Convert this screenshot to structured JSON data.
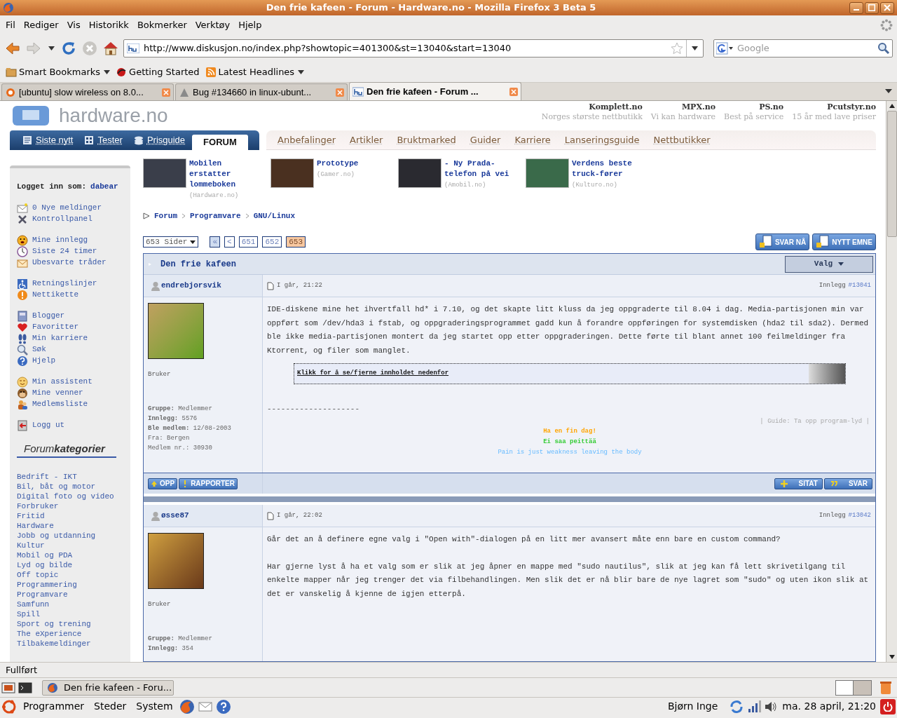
{
  "window": {
    "title": "Den frie kafeen - Forum - Hardware.no - Mozilla Firefox 3 Beta 5"
  },
  "menu": [
    "Fil",
    "Rediger",
    "Vis",
    "Historikk",
    "Bokmerker",
    "Verktøy",
    "Hjelp"
  ],
  "toolbar": {
    "url": "http://www.diskusjon.no/index.php?showtopic=401300&st=13040&start=13040",
    "search_placeholder": "Google"
  },
  "bookmarks": [
    {
      "label": "Smart Bookmarks",
      "menu": true
    },
    {
      "label": "Getting Started",
      "menu": false
    },
    {
      "label": "Latest Headlines",
      "menu": true
    }
  ],
  "tabs": [
    {
      "label": "[ubuntu] slow wireless on 8.0...",
      "selected": false
    },
    {
      "label": "Bug #134660 in linux-ubunt...",
      "selected": false
    },
    {
      "label": "Den frie kafeen - Forum ...",
      "selected": true
    }
  ],
  "page": {
    "logo": "hardware.no",
    "shops": [
      {
        "name": "Komplett.no",
        "tagline": "Norges største nettbutikk"
      },
      {
        "name": "MPX.no",
        "tagline": "Vi kan hardware"
      },
      {
        "name": "PS.no",
        "tagline": "Best på service"
      },
      {
        "name": "Pcutstyr.no",
        "tagline": "15 år med lave priser"
      }
    ],
    "nav_primary": [
      {
        "label": "Siste nytt",
        "selected": false
      },
      {
        "label": "Tester",
        "selected": false
      },
      {
        "label": "Prisguide",
        "selected": false
      },
      {
        "label": "FORUM",
        "selected": true
      }
    ],
    "nav_secondary": [
      "Anbefalinger",
      "Artikler",
      "Bruktmarked",
      "Guider",
      "Karriere",
      "Lanseringsguide",
      "Nettbutikker"
    ],
    "sidebar": {
      "logged_in_label": "Logget inn som:",
      "user": "dabear",
      "groups": [
        [
          "0 Nye meldinger",
          "Kontrollpanel"
        ],
        [
          "Mine innlegg",
          "Siste 24 timer",
          "Ubesvarte tråder"
        ],
        [
          "Retningslinjer",
          "Nettikette"
        ],
        [
          "Blogger",
          "Favoritter",
          "Min karriere",
          "Søk",
          "Hjelp"
        ],
        [
          "Min assistent",
          "Mine venner",
          "Medlemsliste"
        ],
        [
          "Logg ut"
        ]
      ],
      "categories_heading": "Forum**kategorier**",
      "categories": [
        "Bedrift - IKT",
        "Bil, båt og motor",
        "Digital foto og video",
        "Forbruker",
        "Fritid",
        "Hardware",
        "Jobb og utdanning",
        "Kultur",
        "Mobil og PDA",
        "Lyd og bilde",
        "Off topic",
        "Programmering",
        "Programvare",
        "Samfunn",
        "Spill",
        "Sport og trening",
        "The eXperience",
        "Tilbakemeldinger"
      ]
    },
    "news": [
      {
        "title": "Mobilen erstatter lommeboken",
        "source": "(Hardware.no)"
      },
      {
        "title": "Prototype",
        "source": "(Gamer.no)"
      },
      {
        "title": "- Ny Prada-telefon på vei",
        "source": "(Amobil.no)"
      },
      {
        "title": "Verdens beste truck-fører",
        "source": "(Kulturo.no)"
      }
    ],
    "breadcrumb": [
      "Forum",
      "Programvare",
      "GNU/Linux"
    ],
    "pager": {
      "pages_label": "653 Sider",
      "first": "«",
      "prev": "<",
      "pages": [
        {
          "label": "651",
          "selected": false
        },
        {
          "label": "652",
          "selected": false
        },
        {
          "label": "653",
          "selected": true
        }
      ]
    },
    "actions": [
      "SVAR NÅ",
      "NYTT EMNE"
    ],
    "topic": {
      "title": "Den frie kafeen",
      "options": "Valg"
    },
    "posts": [
      {
        "author": "endrebjorsvik",
        "time": "I går, 21:22",
        "post_label": "Innlegg",
        "post_number": "#13041",
        "rank": "Bruker",
        "info": [
          "**Gruppe:** Medlemmer",
          "**Innlegg:** 5576",
          "**Ble medlem:** 12/08-2003",
          "Fra: Bergen",
          "Medlem nr.: 30930"
        ],
        "paragraphs": [
          "IDE-diskene mine het ihvertfall hd* i 7.10, og det skapte litt kluss da jeg oppgraderte til 8.04 i dag. Media-partisjonen min var oppført som /dev/hda3 i fstab, og oppgraderingsprogrammet gadd kun å forandre oppføringen for systemdisken (hda2 til sda2). Dermed ble ikke media-partisjonen montert da jeg startet opp etter oppgraderingen. Dette førte til blant annet 100 feilmeldinger fra Ktorrent, og filer som manglet."
        ],
        "spoiler": "Klikk for å se/fjerne innholdet nedenfor",
        "signature": {
          "rule": "--------------------",
          "guide": "| Guide: Ta opp program-lyd |",
          "lines": [
            {
              "text": "Ha en fin dag!",
              "color": "#ffa500"
            },
            {
              "text": "Ei saa peittää",
              "color": "#33cc33"
            },
            {
              "text": "Pain is just weakness leaving the body",
              "color": "#66bbff"
            }
          ]
        },
        "footer_left": [
          "OPP",
          "RAPPORTER"
        ],
        "footer_right": [
          "SITAT",
          "SVAR"
        ]
      },
      {
        "author": "øsse87",
        "time": "I går, 22:02",
        "post_label": "Innlegg",
        "post_number": "#13042",
        "rank": "Bruker",
        "info": [
          "**Gruppe:** Medlemmer",
          "**Innlegg:** 354"
        ],
        "paragraphs": [
          "Går det an å definere egne valg i \"Open with\"-dialogen på en litt mer avansert måte enn bare en custom command?",
          "Har gjerne lyst å ha et valg som er slik at jeg åpner en mappe med \"sudo nautilus\", slik at jeg kan få lett skrivetilgang til enkelte mapper når jeg trenger det via filbehandlingen. Men slik det er nå blir bare de nye lagret som \"sudo\" og uten ikon slik at det er vanskelig å kjenne de igjen etterpå."
        ]
      }
    ]
  },
  "status_bar": "Fullført",
  "taskbar": [
    {
      "label": "Den frie kafeen - Foru..."
    }
  ],
  "panel": {
    "menus": [
      "Programmer",
      "Steder",
      "System"
    ],
    "user": "Bjørn Inge",
    "clock": "ma. 28 april, 21:20"
  }
}
